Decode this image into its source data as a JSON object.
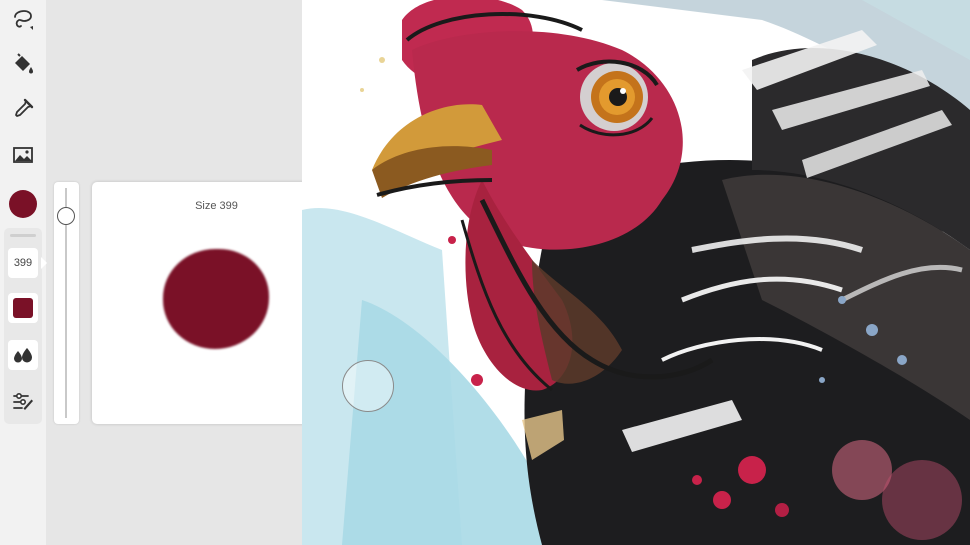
{
  "toolbar": {
    "tools": [
      {
        "name": "lasso-icon"
      },
      {
        "name": "paint-bucket-icon"
      },
      {
        "name": "eyedropper-icon"
      },
      {
        "name": "image-icon"
      }
    ],
    "current_color": "#7a1127",
    "brush": {
      "size_value": "399",
      "swatch_color": "#7a1127",
      "flow_icon": "droplets-icon",
      "settings_icon": "brush-settings-icon"
    }
  },
  "size_slider": {
    "value_fraction": 0.09
  },
  "size_preview": {
    "label": "Size 399",
    "dab_color": "#7a1127"
  },
  "canvas": {
    "description_colors": {
      "comb": "#b3244a",
      "beak": "#c8922f",
      "dark": "#1a1a1a",
      "wash": "#a9d9e6"
    }
  }
}
